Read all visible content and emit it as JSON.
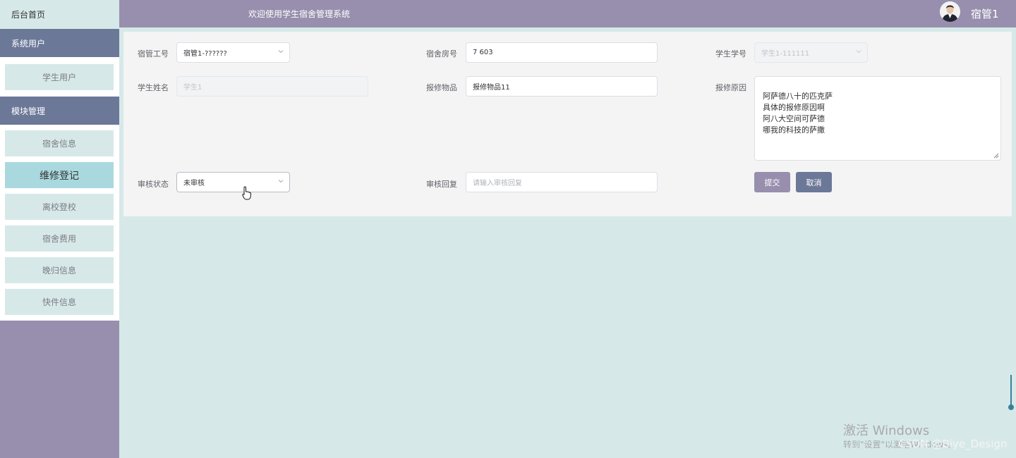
{
  "sidebar": {
    "brand": "后台首页",
    "groups": [
      {
        "title": "系统用户",
        "items": [
          {
            "label": "学生用户"
          }
        ]
      },
      {
        "title": "模块管理",
        "items": [
          {
            "label": "宿舍信息"
          },
          {
            "label": "维修登记"
          },
          {
            "label": "离校登校"
          },
          {
            "label": "宿舍费用"
          },
          {
            "label": "晚归信息"
          },
          {
            "label": "快件信息"
          }
        ]
      }
    ]
  },
  "header": {
    "welcome": "欢迎使用学生宿舍管理系统",
    "username": "宿管1",
    "avatar_icon": "user-avatar-icon"
  },
  "form": {
    "fields": {
      "staff_no": {
        "label": "宿管工号",
        "value": "宿管1-??????"
      },
      "room_no": {
        "label": "宿舍房号",
        "value": "7 603"
      },
      "student_no": {
        "label": "学生学号",
        "value": "学生1-111111"
      },
      "student_name": {
        "label": "学生姓名",
        "value": "学生1"
      },
      "repair_item": {
        "label": "报修物品",
        "value": "报修物品11"
      },
      "repair_reason": {
        "label": "报修原因",
        "value": "阿萨德八十的匹克萨\n具体的报修原因啊\n阿八大空间可萨德\n哪我的科技的萨撒"
      },
      "review_status": {
        "label": "审核状态",
        "value": "未审核"
      },
      "review_reply": {
        "label": "审核回复",
        "placeholder": "请输入审核回复"
      }
    },
    "buttons": {
      "submit": "提交",
      "cancel": "取消"
    }
  },
  "overlay": {
    "watermark_title": "激活 Windows",
    "watermark_sub": "转到\"设置\"以激活Windows。",
    "csdn": "CSDN @Biye_Design"
  },
  "colors": {
    "header": "#978fad",
    "group_title": "#6c7898",
    "menu_item": "#d6e9e8",
    "menu_active": "#a9d9de",
    "background": "#d6e9e8"
  }
}
